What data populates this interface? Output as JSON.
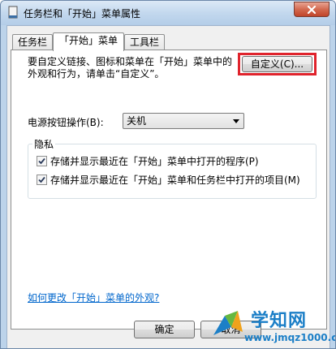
{
  "window": {
    "title": "任务栏和「开始」菜单属性"
  },
  "tabs": [
    {
      "label": "任务栏"
    },
    {
      "label": "「开始」菜单"
    },
    {
      "label": "工具栏"
    }
  ],
  "start_menu": {
    "description": "要自定义链接、图标和菜单在「开始」菜单中的外观和行为，请单击“自定义”。",
    "customize_label": "自定义(C)...",
    "power_label": "电源按钮操作(B):",
    "power_value": "关机",
    "privacy_legend": "隐私",
    "privacy_items": [
      {
        "label": "存储并显示最近在「开始」菜单中打开的程序(P)",
        "checked": true
      },
      {
        "label": "存储并显示最近在「开始」菜单和任务栏中打开的项目(M)",
        "checked": true
      }
    ],
    "help_link": "如何更改「开始」菜单的外观?"
  },
  "footer": {
    "ok_label": "确定",
    "cancel_label": "取消"
  },
  "watermark": {
    "title": "学知网",
    "url": "www.jmqz1000.com"
  },
  "colors": {
    "highlight": "#e0232c",
    "link": "#0066cc",
    "watermark": "#1c7fc7"
  }
}
